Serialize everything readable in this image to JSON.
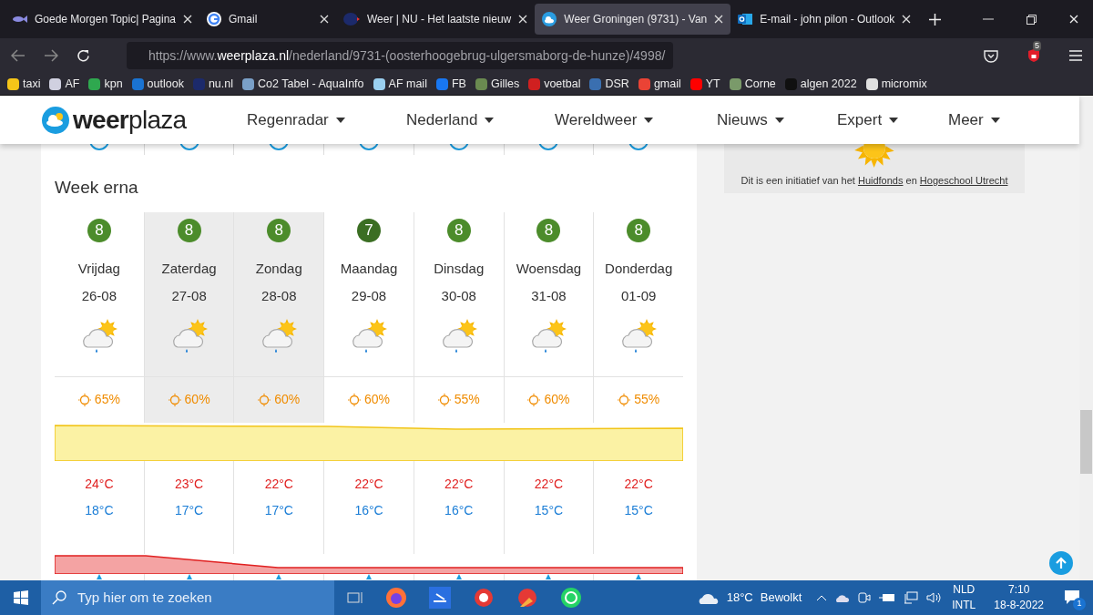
{
  "browser_tabs": [
    {
      "title": "Goede Morgen Topic| Pagina",
      "selected": false
    },
    {
      "title": "Gmail",
      "selected": false
    },
    {
      "title": "Weer | NU - Het laatste nieuw",
      "selected": false
    },
    {
      "title": "Weer Groningen (9731) - Van",
      "selected": true
    },
    {
      "title": "E-mail - john pilon - Outlook",
      "selected": false
    }
  ],
  "address_bar": {
    "prefix": "https://www.",
    "domain": "weerplaza.nl",
    "path": "/nederland/9731-(oosterhoogebrug-ulgersmaborg-de-hunze)/4998/"
  },
  "extension_badge": "5",
  "bookmarks": [
    {
      "label": "taxi",
      "color": "#f5c518"
    },
    {
      "label": "AF",
      "color": "#d0d0e0"
    },
    {
      "label": "kpn",
      "color": "#2fa84f"
    },
    {
      "label": "outlook",
      "color": "#1a73d1"
    },
    {
      "label": "nu.nl",
      "color": "#1c2a6b"
    },
    {
      "label": "Co2 Tabel - AquaInfo",
      "color": "#7aa0c8"
    },
    {
      "label": "AF mail",
      "color": "#9ad0f0"
    },
    {
      "label": "FB",
      "color": "#1877f2"
    },
    {
      "label": "Gilles",
      "color": "#6a8a50"
    },
    {
      "label": "voetbal",
      "color": "#d02020"
    },
    {
      "label": "DSR",
      "color": "#3a6fb0"
    },
    {
      "label": "gmail",
      "color": "#ea4335"
    },
    {
      "label": "YT",
      "color": "#ff0000"
    },
    {
      "label": "Corne",
      "color": "#7a9a6a"
    },
    {
      "label": "algen 2022",
      "color": "#101010"
    },
    {
      "label": "micromix",
      "color": "#e0e0e0"
    }
  ],
  "site": {
    "logo_bold": "weer",
    "logo_light": "plaza",
    "nav": [
      "Regenradar",
      "Nederland",
      "Wereldweer",
      "Nieuws",
      "Expert",
      "Meer"
    ]
  },
  "section_title": "Week erna",
  "days": [
    {
      "score": "8",
      "color": "#4c8c2b",
      "day": "Vrijdag",
      "date": "26-08",
      "sun": "65%",
      "high": "24°C",
      "low": "18°C",
      "weekend": false
    },
    {
      "score": "8",
      "color": "#4c8c2b",
      "day": "Zaterdag",
      "date": "27-08",
      "sun": "60%",
      "high": "23°C",
      "low": "17°C",
      "weekend": true
    },
    {
      "score": "8",
      "color": "#4c8c2b",
      "day": "Zondag",
      "date": "28-08",
      "sun": "60%",
      "high": "22°C",
      "low": "17°C",
      "weekend": true
    },
    {
      "score": "7",
      "color": "#3b6e23",
      "day": "Maandag",
      "date": "29-08",
      "sun": "60%",
      "high": "22°C",
      "low": "16°C",
      "weekend": false
    },
    {
      "score": "8",
      "color": "#4c8c2b",
      "day": "Dinsdag",
      "date": "30-08",
      "sun": "55%",
      "high": "22°C",
      "low": "16°C",
      "weekend": false
    },
    {
      "score": "8",
      "color": "#4c8c2b",
      "day": "Woensdag",
      "date": "31-08",
      "sun": "60%",
      "high": "22°C",
      "low": "15°C",
      "weekend": false
    },
    {
      "score": "8",
      "color": "#4c8c2b",
      "day": "Donderdag",
      "date": "01-09",
      "sun": "55%",
      "high": "22°C",
      "low": "15°C",
      "weekend": false
    }
  ],
  "side_card": {
    "text_before": "Dit is een initiatief van het",
    "link_1": "Huidfonds",
    "text_middle": "en",
    "link_2": "Hogeschool Utrecht"
  },
  "taskbar": {
    "search_placeholder": "Typ hier om te zoeken",
    "weather_temp": "18°C",
    "weather_text": "Bewolkt",
    "language": "NLD",
    "layout": "INTL",
    "time": "7:10",
    "date": "18-8-2022",
    "notifications": "1"
  }
}
